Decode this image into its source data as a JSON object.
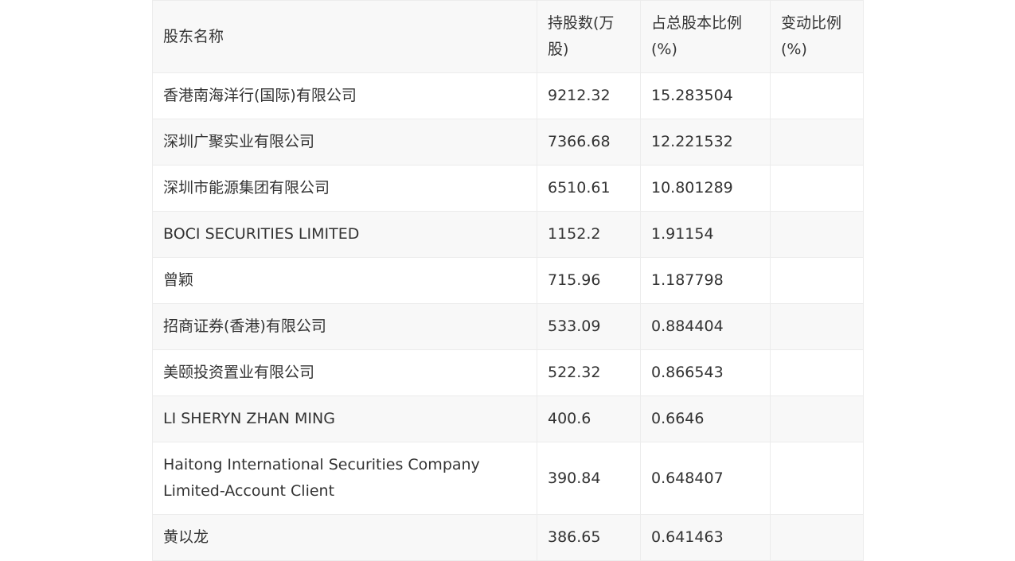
{
  "table": {
    "headers": [
      "股东名称",
      "持股数(万股)",
      "占总股本比例(%)",
      "变动比例(%)"
    ],
    "rows": [
      [
        "香港南海洋行(国际)有限公司",
        "9212.32",
        "15.283504",
        ""
      ],
      [
        "深圳广聚实业有限公司",
        "7366.68",
        "12.221532",
        ""
      ],
      [
        "深圳市能源集团有限公司",
        "6510.61",
        "10.801289",
        ""
      ],
      [
        "BOCI SECURITIES LIMITED",
        "1152.2",
        "1.91154",
        ""
      ],
      [
        "曾颖",
        "715.96",
        "1.187798",
        ""
      ],
      [
        "招商证券(香港)有限公司",
        "533.09",
        "0.884404",
        ""
      ],
      [
        "美颐投资置业有限公司",
        "522.32",
        "0.866543",
        ""
      ],
      [
        "LI SHERYN ZHAN MING",
        "400.6",
        "0.6646",
        ""
      ],
      [
        "Haitong International Securities Company Limited-Account Client",
        "390.84",
        "0.648407",
        ""
      ],
      [
        "黄以龙",
        "386.65",
        "0.641463",
        ""
      ]
    ]
  }
}
